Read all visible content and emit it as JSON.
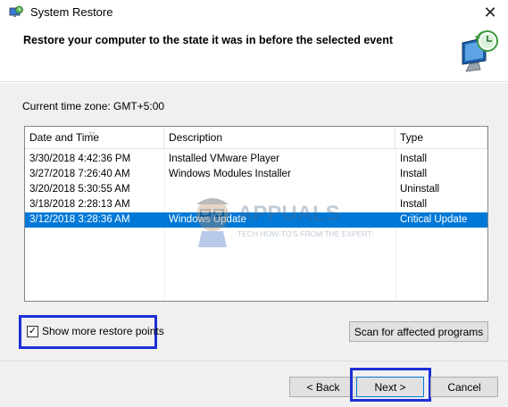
{
  "window": {
    "title": "System Restore",
    "close_glyph": "✕"
  },
  "header": {
    "text": "Restore your computer to the state it was in before the selected event",
    "icon": "system-restore-monitor-icon"
  },
  "timezone": "Current time zone: GMT+5:00",
  "list": {
    "columns": [
      "Date and Time",
      "Description",
      "Type"
    ],
    "rows": [
      {
        "date": "3/30/2018 4:42:36 PM",
        "description": "Installed VMware Player",
        "type": "Install",
        "selected": false
      },
      {
        "date": "3/27/2018 7:26:40 AM",
        "description": "Windows Modules Installer",
        "type": "Install",
        "selected": false
      },
      {
        "date": "3/20/2018 5:30:55 AM",
        "description": "",
        "type": "Uninstall",
        "selected": false
      },
      {
        "date": "3/18/2018 2:28:13 AM",
        "description": "",
        "type": "Install",
        "selected": false
      },
      {
        "date": "3/12/2018 3:28:36 AM",
        "description": "Windows Update",
        "type": "Critical Update",
        "selected": true
      }
    ]
  },
  "watermark": {
    "brand": "APPUALS",
    "tagline": "TECH HOW-TO'S FROM THE EXPERTS!"
  },
  "show_more": {
    "label": "Show more restore points",
    "checked": true,
    "check_glyph": "✓"
  },
  "buttons": {
    "scan": "Scan for affected programs",
    "back": "< Back",
    "next": "Next >",
    "cancel": "Cancel"
  },
  "colors": {
    "selection": "#0078d7",
    "highlight_box": "#1c2fd6"
  }
}
